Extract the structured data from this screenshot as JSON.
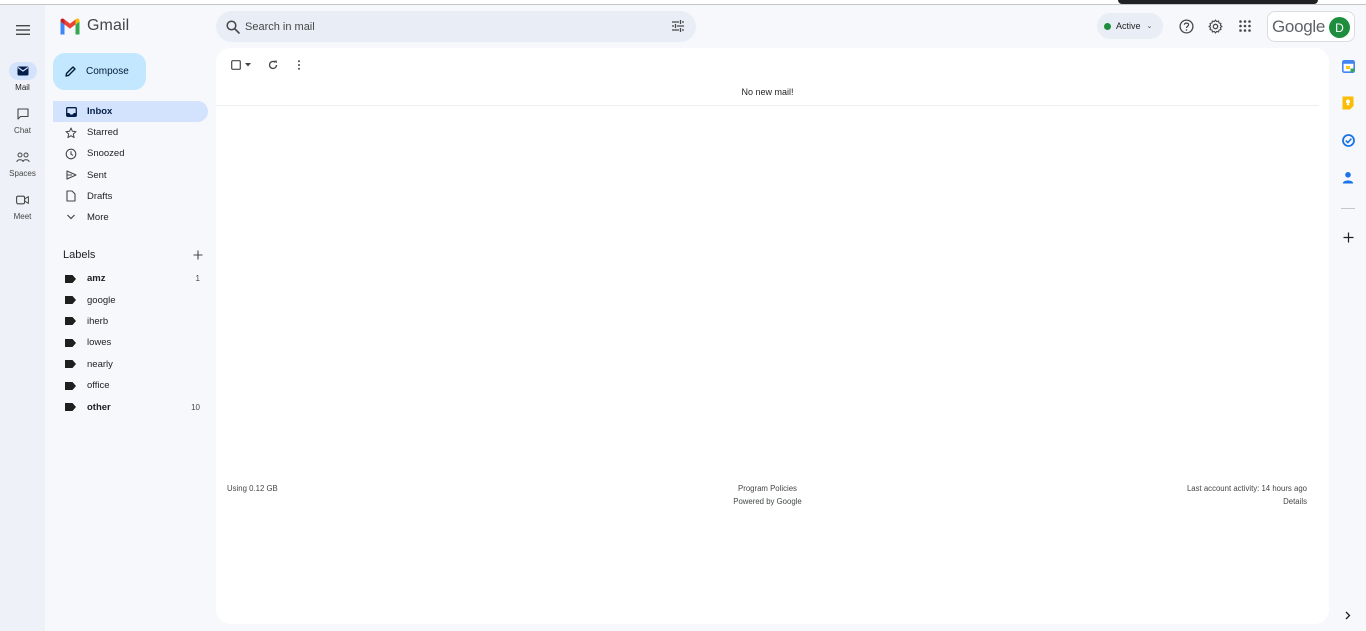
{
  "app": {
    "name": "Gmail",
    "google_word": "Google",
    "avatar_initial": "D"
  },
  "rail": {
    "items": [
      {
        "label": "Mail",
        "icon": "mail-icon"
      },
      {
        "label": "Chat",
        "icon": "chat-icon"
      },
      {
        "label": "Spaces",
        "icon": "spaces-icon"
      },
      {
        "label": "Meet",
        "icon": "meet-icon"
      }
    ]
  },
  "search": {
    "placeholder": "Search in mail",
    "value": ""
  },
  "status": {
    "label": "Active"
  },
  "compose": {
    "label": "Compose"
  },
  "nav": {
    "items": [
      {
        "label": "Inbox",
        "icon": "inbox-icon",
        "active": true
      },
      {
        "label": "Starred",
        "icon": "star-icon"
      },
      {
        "label": "Snoozed",
        "icon": "clock-icon"
      },
      {
        "label": "Sent",
        "icon": "send-icon"
      },
      {
        "label": "Drafts",
        "icon": "draft-icon"
      },
      {
        "label": "More",
        "icon": "chevron-down-icon"
      }
    ]
  },
  "labels": {
    "title": "Labels",
    "items": [
      {
        "name": "amz",
        "count": "1"
      },
      {
        "name": "google",
        "count": ""
      },
      {
        "name": "iherb",
        "count": ""
      },
      {
        "name": "lowes",
        "count": ""
      },
      {
        "name": "nearly",
        "count": ""
      },
      {
        "name": "office",
        "count": ""
      },
      {
        "name": "other",
        "count": "10"
      }
    ]
  },
  "main": {
    "empty_message": "No new mail!"
  },
  "footer": {
    "storage": "Using 0.12 GB",
    "policies": "Program Policies",
    "powered": "Powered by Google",
    "activity": "Last account activity: 14 hours ago",
    "details": "Details"
  },
  "colors": {
    "accent": "#0b57d0",
    "active_nav": "#d3e3fd",
    "compose": "#c2e7ff",
    "status_green": "#1e8e3e"
  }
}
